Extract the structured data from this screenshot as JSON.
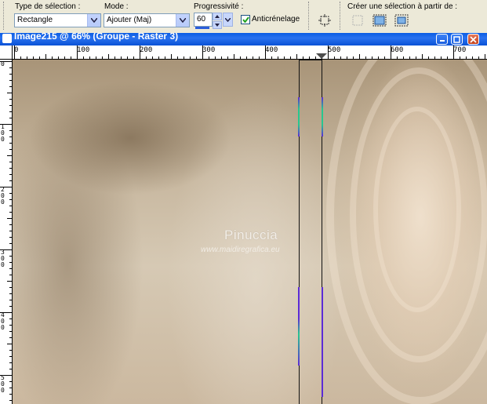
{
  "toolbar": {
    "selection_type": {
      "label": "Type de sélection :",
      "value": "Rectangle"
    },
    "mode": {
      "label": "Mode :",
      "value": "Ajouter (Maj)"
    },
    "feather": {
      "label": "Progressivité :",
      "value": "60"
    },
    "antialias": {
      "label": "Anticrénelage",
      "checked": true
    },
    "create_from": {
      "label": "Créer une sélection à partir de :",
      "icons": [
        "selection-from-layer-icon",
        "selection-from-canvas-icon",
        "selection-from-opaque-icon"
      ]
    },
    "custom_selection_icon": "custom-selection-icon"
  },
  "window": {
    "title": "Image215 @ 66% (Groupe - Raster 3)"
  },
  "rulers": {
    "top": [
      "0",
      "100",
      "200",
      "300",
      "400",
      "500",
      "600",
      "700"
    ],
    "left": [
      "0",
      "100",
      "200",
      "300",
      "400",
      "500"
    ]
  },
  "canvas": {
    "watermark_title": "Pinuccia",
    "watermark_url": "www.maidiregrafica.eu"
  },
  "colors": {
    "accent": "#0a52d6",
    "close": "#c4421c",
    "selection_marker": "#5b2bd6",
    "marker_green": "#27c78f"
  }
}
